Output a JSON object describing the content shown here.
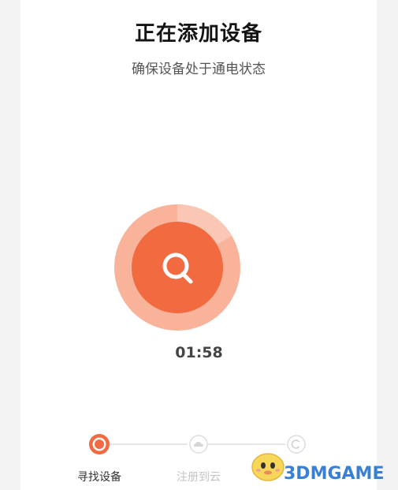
{
  "header": {
    "title": "正在添加设备",
    "subtitle": "确保设备处于通电状态"
  },
  "scanner": {
    "icon": "search-icon",
    "accent": "#f26a3f",
    "accent_light": "#f9b39a",
    "timer": "01:58"
  },
  "steps": [
    {
      "label": "寻找设备",
      "icon": "target-dot-icon",
      "state": "active"
    },
    {
      "label": "注册到云",
      "icon": "cloud-icon",
      "state": "pending"
    },
    {
      "label": "",
      "icon": "check-circle-icon",
      "state": "pending"
    }
  ],
  "watermark": {
    "text": "3DMGAME"
  },
  "colors": {
    "background": "#f3f3f3",
    "card": "#ffffff",
    "inactive": "#d9d9d9"
  }
}
